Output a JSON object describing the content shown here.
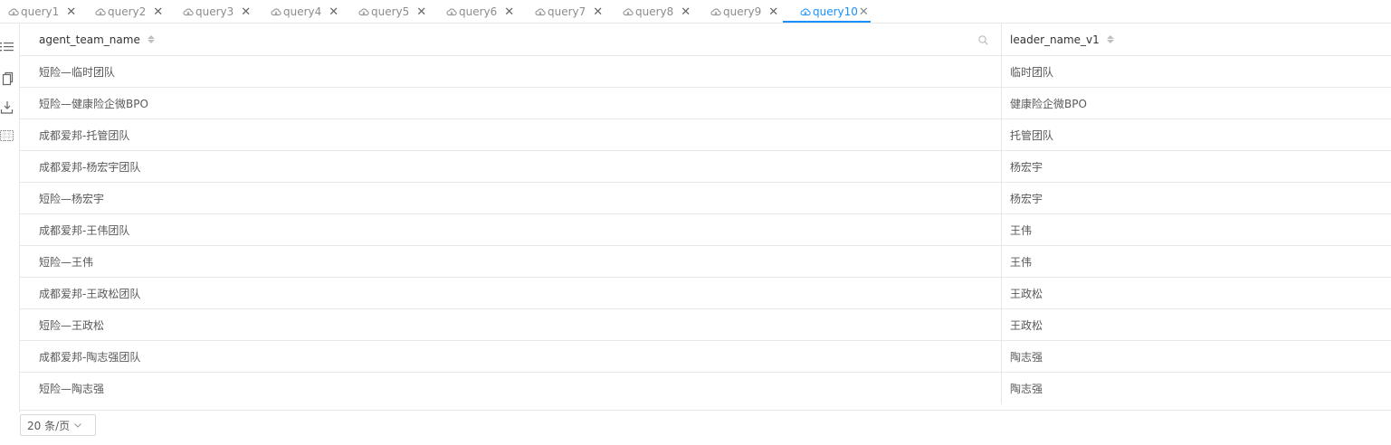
{
  "tabs": [
    {
      "label": "query1",
      "active": false
    },
    {
      "label": "query2",
      "active": false
    },
    {
      "label": "query3",
      "active": false
    },
    {
      "label": "query4",
      "active": false
    },
    {
      "label": "query5",
      "active": false
    },
    {
      "label": "query6",
      "active": false
    },
    {
      "label": "query7",
      "active": false
    },
    {
      "label": "query8",
      "active": false
    },
    {
      "label": "query9",
      "active": false
    },
    {
      "label": "query10",
      "active": true
    }
  ],
  "toolbar": {
    "icons": [
      "list-icon",
      "copy-icon",
      "download-icon",
      "table-settings-icon"
    ]
  },
  "table": {
    "columns": [
      "agent_team_name",
      "leader_name_v1"
    ],
    "rows": [
      [
        "短险—临时团队",
        "临时团队"
      ],
      [
        "短险—健康险企微BPO",
        "健康险企微BPO"
      ],
      [
        "成都爱邦-托管团队",
        "托管团队"
      ],
      [
        "成都爱邦-杨宏宇团队",
        "杨宏宇"
      ],
      [
        "短险—杨宏宇",
        "杨宏宇"
      ],
      [
        "成都爱邦-王伟团队",
        "王伟"
      ],
      [
        "短险—王伟",
        "王伟"
      ],
      [
        "成都爱邦-王政松团队",
        "王政松"
      ],
      [
        "短险—王政松",
        "王政松"
      ],
      [
        "成都爱邦-陶志强团队",
        "陶志强"
      ],
      [
        "短险—陶志强",
        "陶志强"
      ]
    ]
  },
  "pagination": {
    "page_size_label": "20 条/页"
  },
  "colors": {
    "accent": "#1890ff",
    "border": "#e8e8e8",
    "muted_text": "#8c8c8c"
  }
}
